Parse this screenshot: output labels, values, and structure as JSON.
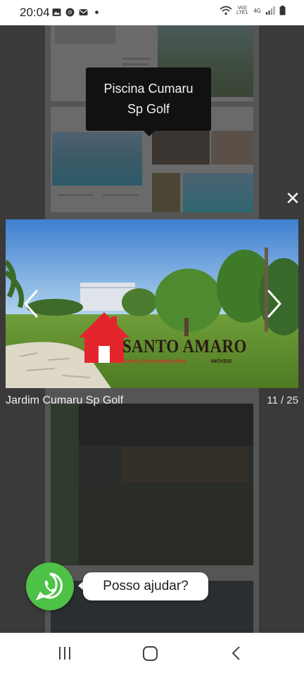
{
  "status_bar": {
    "time": "20:04",
    "left_icons": [
      "gallery-icon",
      "chrome-icon",
      "mail-icon",
      "dot-icon"
    ],
    "network_top": "Vo))",
    "network_bottom": "LTE1",
    "network_type": "4G"
  },
  "tooltip": {
    "line1": "Piscina Cumaru",
    "line2": "Sp Golf"
  },
  "lightbox": {
    "close_label": "✕",
    "caption": "Jardim Cumaru Sp Golf",
    "counter": "11 / 25",
    "watermark": {
      "brand": "SANTO AMARO",
      "subtitle": "CONSULTORIA IMOBILIÁRIA",
      "tagline": "IMÓVEIS"
    }
  },
  "whatsapp": {
    "bubble_text": "Posso ajudar?",
    "color": "#4dc247"
  },
  "nav_bar": {
    "buttons": [
      "recent-apps",
      "home",
      "back"
    ]
  }
}
